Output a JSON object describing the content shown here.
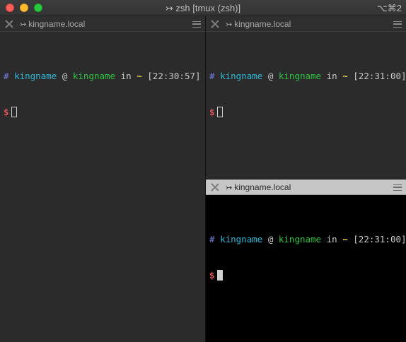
{
  "window": {
    "title": "↣ zsh [tmux (zsh)]",
    "shortcut": "⌥⌘2"
  },
  "colors": {
    "close": "#ff5f57",
    "minimize": "#febc2e",
    "maximize": "#28c840",
    "prompt_hash": "#6f7fe0",
    "prompt_user": "#2fb8d8",
    "prompt_host": "#2ec443",
    "prompt_tilde": "#e5d34a",
    "prompt_dollar": "#e0565b"
  },
  "panes": [
    {
      "title": "kingname.local",
      "active": false,
      "prompt": {
        "hash": "#",
        "user": "kingname",
        "at": "@",
        "host": "kingname",
        "in": "in",
        "dir": "~",
        "time": "[22:30:57]",
        "symbol": "$"
      }
    },
    {
      "title": "kingname.local",
      "active": false,
      "prompt": {
        "hash": "#",
        "user": "kingname",
        "at": "@",
        "host": "kingname",
        "in": "in",
        "dir": "~",
        "time": "[22:31:00]",
        "symbol": "$"
      }
    },
    {
      "title": "kingname.local",
      "active": true,
      "prompt": {
        "hash": "#",
        "user": "kingname",
        "at": "@",
        "host": "kingname",
        "in": "in",
        "dir": "~",
        "time": "[22:31:00]",
        "symbol": "$"
      }
    }
  ],
  "icons": {
    "arrow": "↣",
    "close": "close-icon",
    "menu": "hamburger-menu-icon"
  }
}
